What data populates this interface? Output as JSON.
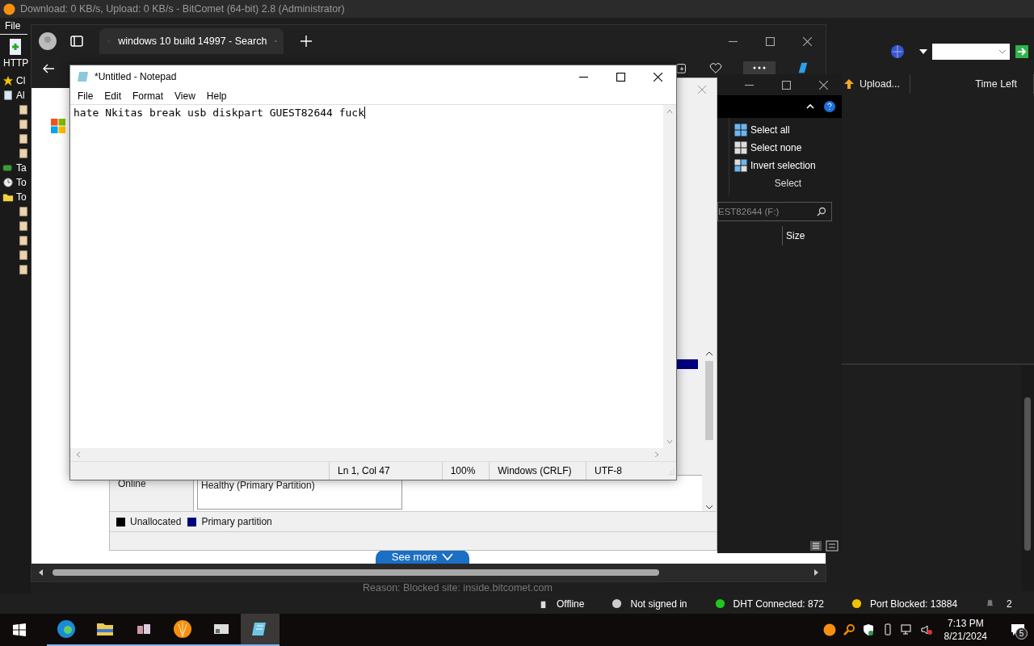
{
  "bitcomet": {
    "title": "Download: 0 KB/s, Upload: 0 KB/s - BitComet (64-bit) 2.8 (Administrator)",
    "menu": [
      "File"
    ],
    "toolbar_label": "HTTP",
    "sidebar": [
      {
        "kind": "star",
        "label": "Cl"
      },
      {
        "kind": "page",
        "label": "Al"
      },
      {
        "kind": "sub"
      },
      {
        "kind": "sub"
      },
      {
        "kind": "sub"
      },
      {
        "kind": "sub"
      },
      {
        "kind": "tag",
        "label": "Ta"
      },
      {
        "kind": "clock",
        "label": "To"
      },
      {
        "kind": "folder",
        "label": "To"
      },
      {
        "kind": "sub"
      },
      {
        "kind": "sub"
      },
      {
        "kind": "sub"
      },
      {
        "kind": "sub"
      },
      {
        "kind": "sub"
      }
    ],
    "columns": [
      "Upload...",
      "Time Left"
    ],
    "reason": "Reason: Blocked site: inside.bitcomet.com",
    "status": [
      {
        "kind": "plug",
        "text": "Offline"
      },
      {
        "kind": "user",
        "text": "Not signed in"
      },
      {
        "kind": "dot",
        "color": "#1fc81f",
        "text": "DHT Connected: 872"
      },
      {
        "kind": "dot",
        "color": "#f2c200",
        "text": "Port Blocked: 13884"
      },
      {
        "kind": "bell",
        "text": "2"
      }
    ]
  },
  "browser": {
    "tab": {
      "title": "windows 10 build 14997 - Search"
    },
    "see_more": "See more"
  },
  "disk_management": {
    "status": "Online",
    "partition": "Healthy (Primary Partition)",
    "legend": [
      {
        "label": "Unallocated",
        "color": "#000000"
      },
      {
        "label": "Primary partition",
        "color": "#000080"
      }
    ]
  },
  "explorer": {
    "actions": [
      "Select all",
      "Select none",
      "Invert selection"
    ],
    "group": "Select",
    "search": {
      "placeholder": "EST82644 (F:)"
    },
    "columns": [
      "Size"
    ]
  },
  "notepad": {
    "title": "*Untitled - Notepad",
    "menu": [
      "File",
      "Edit",
      "Format",
      "View",
      "Help"
    ],
    "text": "hate Nkitas break usb diskpart GUEST82644 fuck",
    "status": [
      "Ln 1, Col 47",
      "100%",
      "Windows (CRLF)",
      "UTF-8"
    ]
  },
  "taskbar": {
    "apps": [
      {
        "kind": "edge",
        "selected": false
      },
      {
        "kind": "folder",
        "selected": false
      },
      {
        "kind": "tools",
        "selected": false
      },
      {
        "kind": "bitcomet",
        "selected": false
      },
      {
        "kind": "drive",
        "selected": false
      },
      {
        "kind": "notepad",
        "selected": true
      }
    ],
    "time": "7:13 PM",
    "date": "8/21/2024",
    "notifications": "5"
  }
}
